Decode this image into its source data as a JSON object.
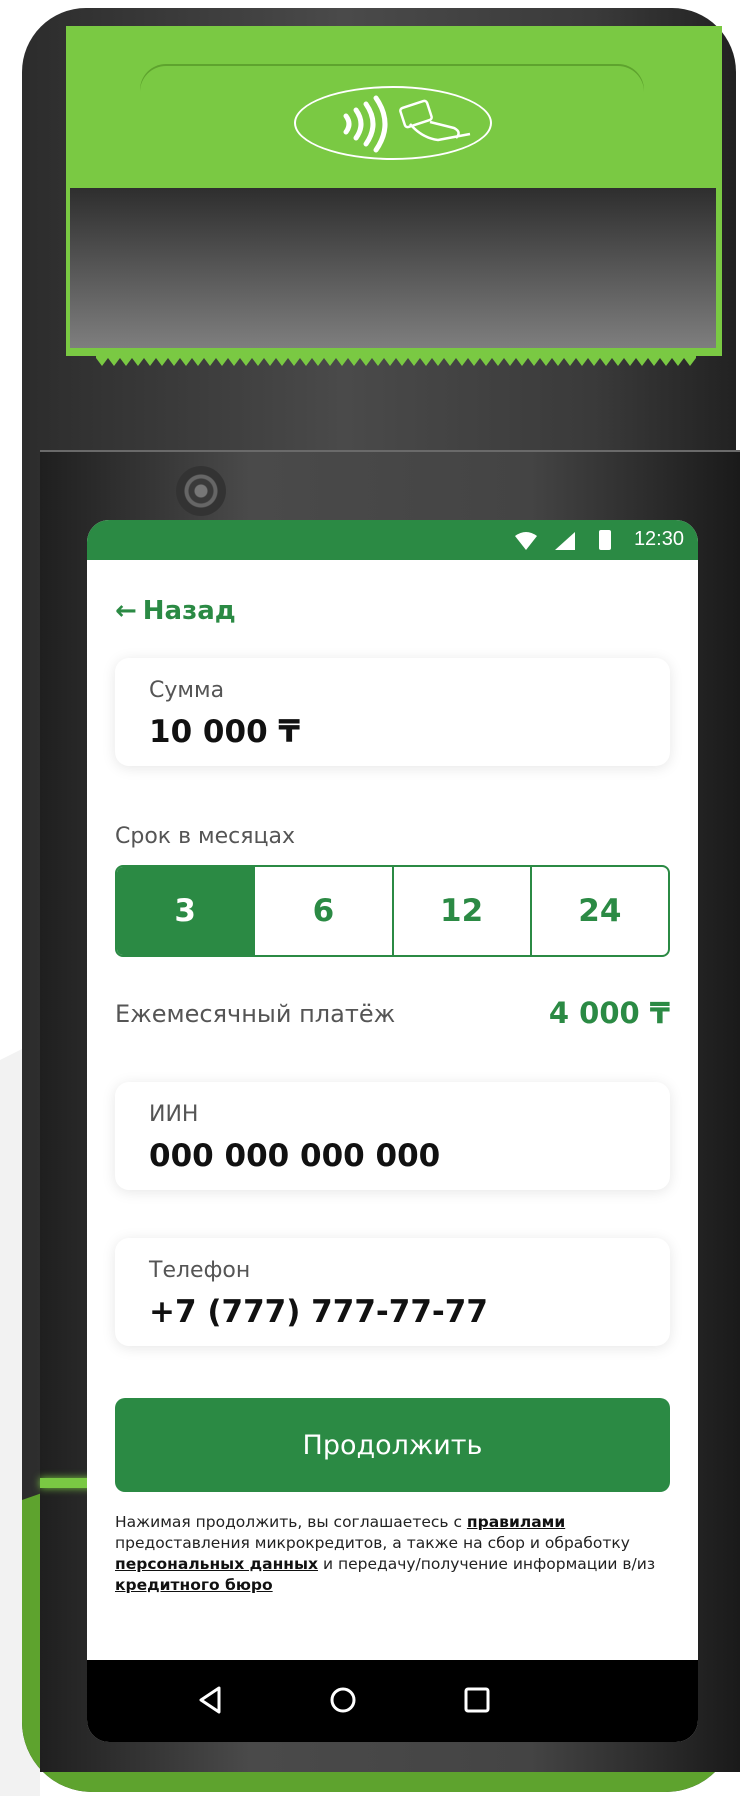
{
  "colors": {
    "brand": "#2b8a44",
    "device_accent": "#7ac943"
  },
  "status_bar": {
    "time": "12:30",
    "icons": [
      "wifi-icon",
      "signal-icon",
      "battery-icon"
    ]
  },
  "back": {
    "label": "Назад",
    "icon": "arrow-left-icon"
  },
  "amount": {
    "label": "Сумма",
    "value": "10 000 ₸"
  },
  "term": {
    "label": "Срок в месяцах",
    "options": [
      "3",
      "6",
      "12",
      "24"
    ],
    "selected": "3"
  },
  "monthly_payment": {
    "label": "Ежемесячный платёж",
    "value": "4 000 ₸"
  },
  "iin": {
    "label": "ИИН",
    "value": "000 000 000 000"
  },
  "phone": {
    "label": "Телефон",
    "value": "+7 (777) 777-77-77"
  },
  "continue_button": {
    "label": "Продолжить"
  },
  "legal": {
    "part1": "Нажимая продолжить, вы соглашаетесь с ",
    "link1": "правилами",
    "part2": " предоставления микрокредитов, а также на сбор и обработку ",
    "link2": "персональных данных",
    "part3": " и передачу/получение информации в/из ",
    "link3": "кредитного бюро"
  },
  "nav_bar": {
    "icons": [
      "back-triangle-icon",
      "home-circle-icon",
      "recents-square-icon"
    ]
  }
}
